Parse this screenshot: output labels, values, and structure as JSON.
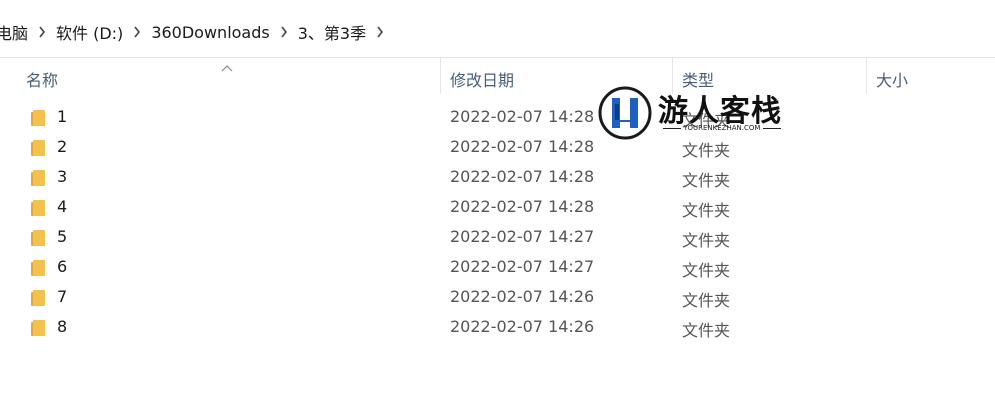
{
  "breadcrumb": {
    "items": [
      "电脑",
      "软件 (D:)",
      "360Downloads",
      "3、第3季"
    ]
  },
  "columns": {
    "name": "名称",
    "date": "修改日期",
    "type": "类型",
    "size": "大小"
  },
  "rows": [
    {
      "name": "1",
      "date": "2022-02-07 14:28",
      "type": "文件夹"
    },
    {
      "name": "2",
      "date": "2022-02-07 14:28",
      "type": "文件夹"
    },
    {
      "name": "3",
      "date": "2022-02-07 14:28",
      "type": "文件夹"
    },
    {
      "name": "4",
      "date": "2022-02-07 14:28",
      "type": "文件夹"
    },
    {
      "name": "5",
      "date": "2022-02-07 14:27",
      "type": "文件夹"
    },
    {
      "name": "6",
      "date": "2022-02-07 14:27",
      "type": "文件夹"
    },
    {
      "name": "7",
      "date": "2022-02-07 14:26",
      "type": "文件夹"
    },
    {
      "name": "8",
      "date": "2022-02-07 14:26",
      "type": "文件夹"
    }
  ],
  "watermark": {
    "title": "游人客栈",
    "subtitle": "YOURENKEZHAN.COM"
  },
  "colors": {
    "folder": "#f2c14e",
    "folder_dark": "#e5a93a",
    "header_text": "#4a5d7a",
    "logo_blue": "#1f5fbf"
  },
  "icons": {
    "folder": "folder-icon",
    "chevron": "chevron-right-icon",
    "sort": "sort-ascending-icon"
  }
}
